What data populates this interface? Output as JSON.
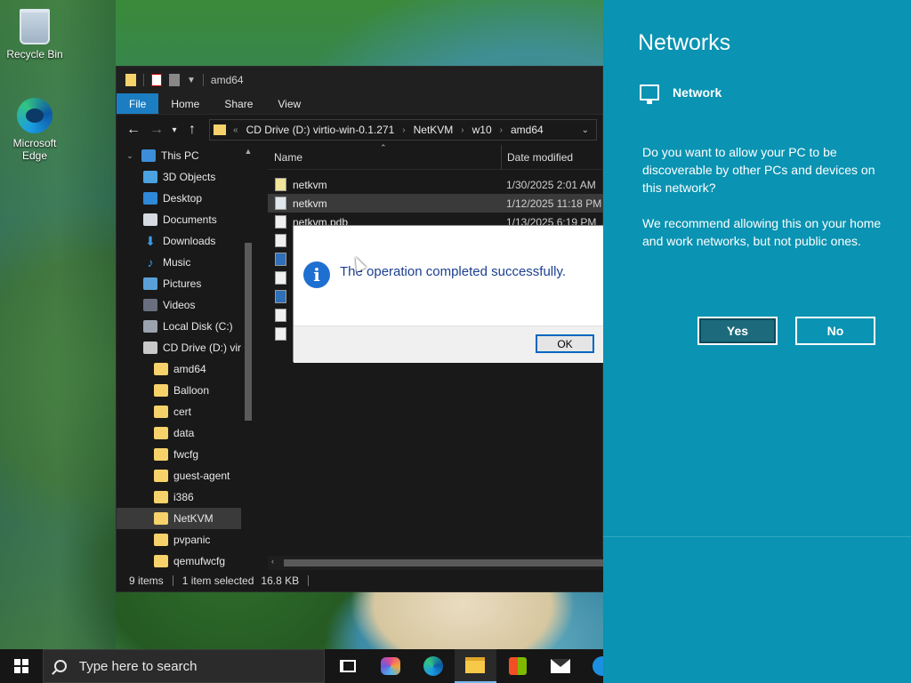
{
  "desktop": {
    "icons": [
      {
        "label": "Recycle Bin",
        "icon": "recycle-bin-icon"
      },
      {
        "label": "Microsoft Edge",
        "icon": "edge-icon"
      }
    ]
  },
  "explorer": {
    "title": "amd64",
    "ribbon_tabs": [
      "File",
      "Home",
      "Share",
      "View"
    ],
    "breadcrumbs": [
      "CD Drive (D:) virtio-win-0.1.271",
      "NetKVM",
      "w10",
      "amd64"
    ],
    "nav_items": [
      {
        "label": "This PC",
        "icon": "pc-icon"
      },
      {
        "label": "3D Objects",
        "icon": "3d-objects-icon"
      },
      {
        "label": "Desktop",
        "icon": "desktop-icon"
      },
      {
        "label": "Documents",
        "icon": "documents-icon"
      },
      {
        "label": "Downloads",
        "icon": "downloads-icon"
      },
      {
        "label": "Music",
        "icon": "music-icon"
      },
      {
        "label": "Pictures",
        "icon": "pictures-icon"
      },
      {
        "label": "Videos",
        "icon": "videos-icon"
      },
      {
        "label": "Local Disk (C:)",
        "icon": "disk-icon"
      },
      {
        "label": "CD Drive (D:) virt",
        "icon": "cd-drive-icon"
      },
      {
        "label": "amd64",
        "icon": "folder-icon"
      },
      {
        "label": "Balloon",
        "icon": "folder-icon"
      },
      {
        "label": "cert",
        "icon": "folder-icon"
      },
      {
        "label": "data",
        "icon": "folder-icon"
      },
      {
        "label": "fwcfg",
        "icon": "folder-icon"
      },
      {
        "label": "guest-agent",
        "icon": "folder-icon"
      },
      {
        "label": "i386",
        "icon": "folder-icon"
      },
      {
        "label": "NetKVM",
        "icon": "folder-icon",
        "selected": true
      },
      {
        "label": "pvpanic",
        "icon": "folder-icon"
      },
      {
        "label": "qemufwcfg",
        "icon": "folder-icon"
      }
    ],
    "columns": {
      "name": "Name",
      "date": "Date modified"
    },
    "files": [
      {
        "name": "netkvm",
        "date": "1/30/2025 2:01 AM",
        "icon": "catalog-file-icon"
      },
      {
        "name": "netkvm",
        "date": "1/12/2025 11:18 PM",
        "icon": "inf-file-icon",
        "selected": true
      },
      {
        "name": "netkvm.pdb",
        "date": "1/13/2025 6:19 PM",
        "icon": "file-icon"
      }
    ],
    "status": {
      "items": "9 items",
      "selected": "1 item selected",
      "size": "16.8 KB"
    }
  },
  "dialog": {
    "message": "The operation completed successfully.",
    "ok_label": "OK"
  },
  "networks": {
    "title": "Networks",
    "network_name": "Network",
    "question": "Do you want to allow your PC to be discoverable by other PCs and devices on this network?",
    "recommendation": "We recommend allowing this on your home and work networks, but not public ones.",
    "yes_label": "Yes",
    "no_label": "No"
  },
  "taskbar": {
    "search_placeholder": "Type here to search",
    "apps": [
      "task-view-icon",
      "copilot-icon",
      "edge-icon",
      "file-explorer-icon",
      "store-icon",
      "mail-icon"
    ]
  }
}
